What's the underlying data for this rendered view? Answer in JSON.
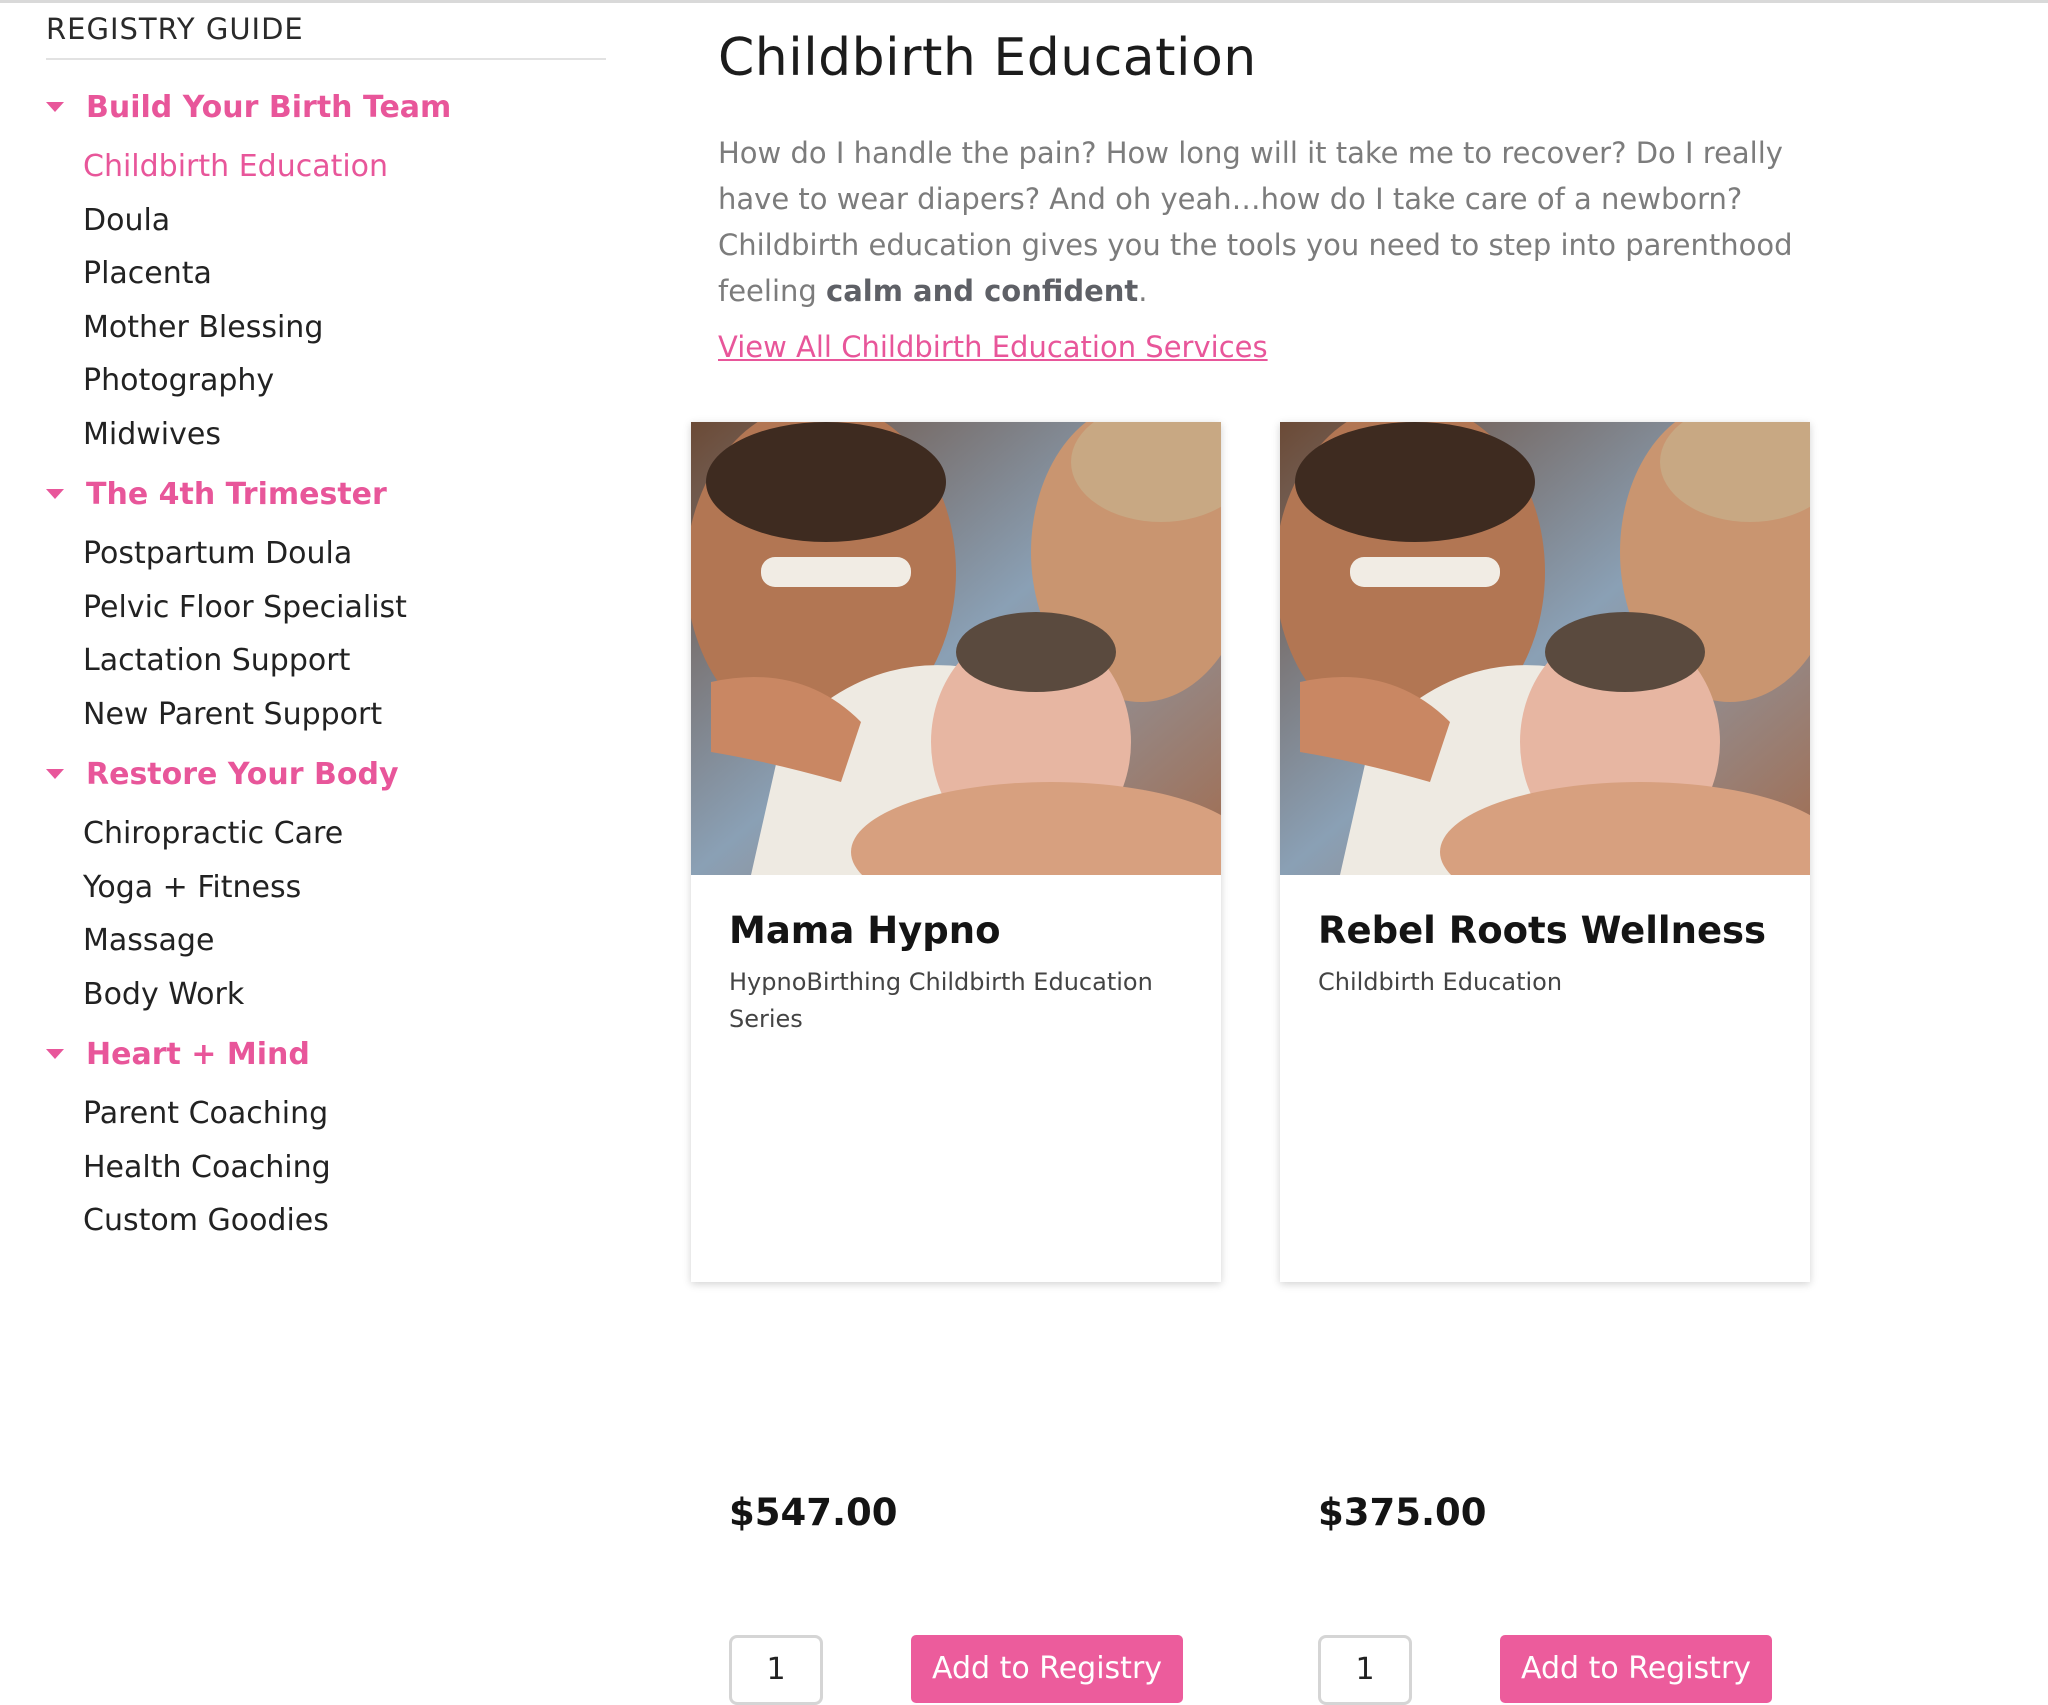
{
  "sidebar": {
    "title": "REGISTRY GUIDE",
    "groups": [
      {
        "label": "Build Your Birth Team",
        "items": [
          "Childbirth Education",
          "Doula",
          "Placenta",
          "Mother Blessing",
          "Photography",
          "Midwives"
        ]
      },
      {
        "label": "The 4th Trimester",
        "items": [
          "Postpartum Doula",
          "Pelvic Floor Specialist",
          "Lactation Support",
          "New Parent Support"
        ]
      },
      {
        "label": "Restore Your Body",
        "items": [
          "Chiropractic Care",
          "Yoga + Fitness",
          "Massage",
          "Body Work"
        ]
      },
      {
        "label": "Heart + Mind",
        "items": [
          "Parent Coaching",
          "Health Coaching",
          "Custom Goodies"
        ]
      }
    ],
    "active_item": "Childbirth Education"
  },
  "main": {
    "title": "Childbirth Education",
    "intro_text": "How do I handle the pain? How long will it take me to recover? Do I really have to wear diapers? And oh yeah…how do I take care of a newborn? Childbirth education gives you the tools you need to step into parenthood feeling ",
    "intro_bold": "calm and confident",
    "intro_end": ".",
    "view_all_link": "View All Childbirth Education Services",
    "cards": [
      {
        "name": "Mama Hypno",
        "subtitle": "HypnoBirthing Childbirth Education Series",
        "price": "$547.00",
        "qty": "1",
        "button": "Add to Registry"
      },
      {
        "name": "Rebel Roots Wellness",
        "subtitle": "Childbirth Education",
        "price": "$375.00",
        "qty": "1",
        "button": "Add to Registry"
      }
    ]
  },
  "colors": {
    "accent": "#e8569a",
    "button": "#ec5c9c"
  }
}
